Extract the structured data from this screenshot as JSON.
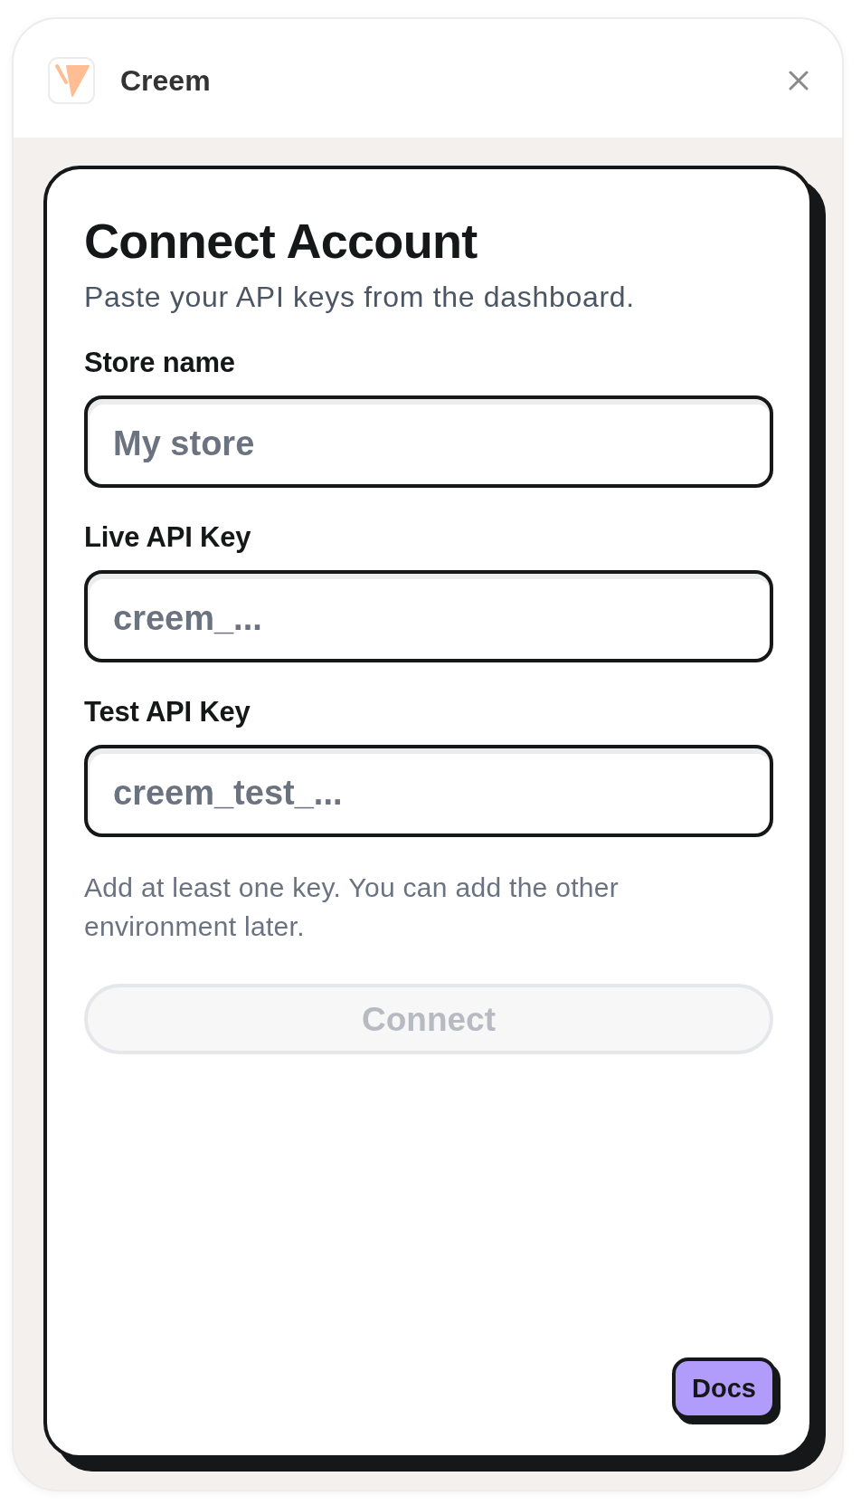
{
  "app": {
    "name": "Creem"
  },
  "form": {
    "title": "Connect Account",
    "subtitle": "Paste your API keys from the dashboard.",
    "fields": [
      {
        "label": "Store name",
        "placeholder": "My store"
      },
      {
        "label": "Live API Key",
        "placeholder": "creem_..."
      },
      {
        "label": "Test API Key",
        "placeholder": "creem_test_..."
      }
    ],
    "hint": "Add at least one key. You can add the other environment later.",
    "submit": {
      "label": "Connect",
      "disabled": true
    }
  },
  "docs_button": {
    "label": "Docs"
  }
}
